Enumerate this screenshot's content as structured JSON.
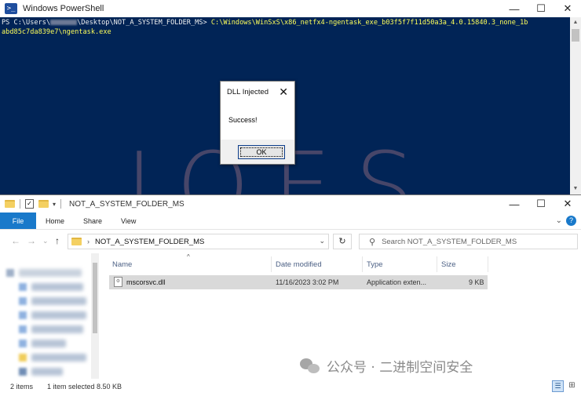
{
  "powershell": {
    "title": "Windows PowerShell",
    "prompt_prefix": "PS C:\\Users\\",
    "prompt_suffix": "\\Desktop\\NOT_A_SYSTEM_FOLDER_MS>",
    "command_line1": "C:\\Windows\\WinSxS\\x86_netfx4-ngentask_exe_b03f5f7f11d50a3a_4.0.15840.3_none_1b",
    "command_line2": "abd85c7da839e7\\ngentask.exe",
    "controls": {
      "minimize": "—",
      "maximize": "☐",
      "close": "✕"
    }
  },
  "message_box": {
    "title": "DLL Injected",
    "text": "Success!",
    "ok_label": "OK",
    "close_glyph": "✕"
  },
  "watermark": "JOES",
  "explorer": {
    "title": "NOT_A_SYSTEM_FOLDER_MS",
    "quick_access_dropdown": "▾",
    "controls": {
      "minimize": "—",
      "maximize": "☐",
      "close": "✕"
    },
    "ribbon": {
      "tabs": [
        "File",
        "Home",
        "Share",
        "View"
      ],
      "expand_glyph": "⌄",
      "help_glyph": "?"
    },
    "nav": {
      "back": "←",
      "forward": "→",
      "recent": "⌄",
      "up": "↑"
    },
    "address": {
      "separator": "›",
      "path": "NOT_A_SYSTEM_FOLDER_MS",
      "dropdown": "⌄"
    },
    "refresh_glyph": "↻",
    "search": {
      "icon": "⚲",
      "placeholder": "Search NOT_A_SYSTEM_FOLDER_MS"
    },
    "columns": [
      "Name",
      "Date modified",
      "Type",
      "Size"
    ],
    "sort_caret": "^",
    "files": [
      {
        "name": "mscorsvc.dll",
        "date_modified": "11/16/2023 3:02 PM",
        "type": "Application exten...",
        "size": "9 KB"
      }
    ],
    "status": {
      "item_count": "2 items",
      "selection": "1 item selected  8.50 KB"
    },
    "view_icons": {
      "details": "☰",
      "large": "⊞"
    }
  },
  "credit": {
    "text": "公众号 · 二进制空间安全"
  }
}
